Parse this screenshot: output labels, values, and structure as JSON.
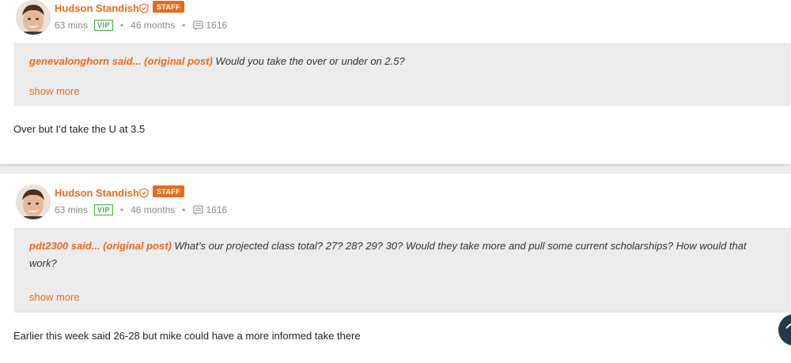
{
  "colors": {
    "accent": "#e86b1c",
    "vip": "#44aa44",
    "quote_bg": "#ececec"
  },
  "posts": [
    {
      "author": "Hudson Standish",
      "badge": "STAFF",
      "time": "63 mins",
      "vip": "VIP",
      "tenure": "46 months",
      "message_count": "1616",
      "quote": {
        "user": "genevalonghorn",
        "said": " said... (",
        "link": "original post",
        "close": ")",
        "text": " Would you take the over or under on 2.5?"
      },
      "show_more": "show more",
      "body": "Over but I’d take the U at 3.5"
    },
    {
      "author": "Hudson Standish",
      "badge": "STAFF",
      "time": "63 mins",
      "vip": "VIP",
      "tenure": "46 months",
      "message_count": "1616",
      "quote": {
        "user": "pdt2300",
        "said": " said... (",
        "link": "original post",
        "close": ")",
        "text": " What’s our projected class total? 27? 28? 29? 30? Would they take more and pull some current scholarships? How would that work?"
      },
      "show_more": "show more",
      "body": "Earlier this week said 26-28 but mike could have a more informed take there"
    }
  ],
  "icons": {
    "shield": "shield-icon",
    "messages": "message-icon",
    "scroll_top": "chevron-up-icon"
  }
}
